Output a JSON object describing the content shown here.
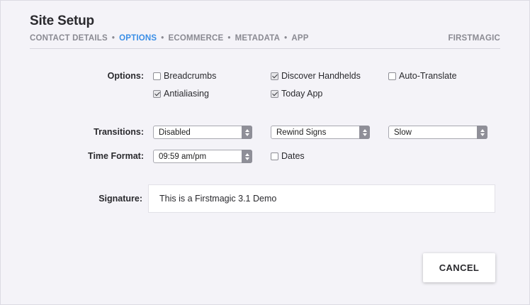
{
  "header": {
    "title": "Site Setup",
    "brand": "FIRSTMAGIC",
    "breadcrumb": [
      {
        "label": "CONTACT DETAILS",
        "active": false
      },
      {
        "label": "OPTIONS",
        "active": true
      },
      {
        "label": "ECOMMERCE",
        "active": false
      },
      {
        "label": "METADATA",
        "active": false
      },
      {
        "label": "APP",
        "active": false
      }
    ],
    "separator": "•"
  },
  "options": {
    "label": "Options:",
    "items": [
      {
        "label": "Breadcrumbs",
        "checked": false
      },
      {
        "label": "Discover Handhelds",
        "checked": true
      },
      {
        "label": "Auto-Translate",
        "checked": false
      },
      {
        "label": "Antialiasing",
        "checked": true
      },
      {
        "label": "Today App",
        "checked": true
      }
    ]
  },
  "transitions": {
    "label": "Transitions:",
    "selects": [
      "Disabled",
      "Rewind Signs",
      "Slow"
    ]
  },
  "time_format": {
    "label": "Time Format:",
    "value": "09:59 am/pm",
    "dates": {
      "label": "Dates",
      "checked": false
    }
  },
  "signature": {
    "label": "Signature:",
    "value": "This is a Firstmagic 3.1 Demo"
  },
  "actions": {
    "cancel_label": "CANCEL"
  },
  "colors": {
    "accent": "#3a8ee6",
    "background": "#f4f3f8"
  }
}
